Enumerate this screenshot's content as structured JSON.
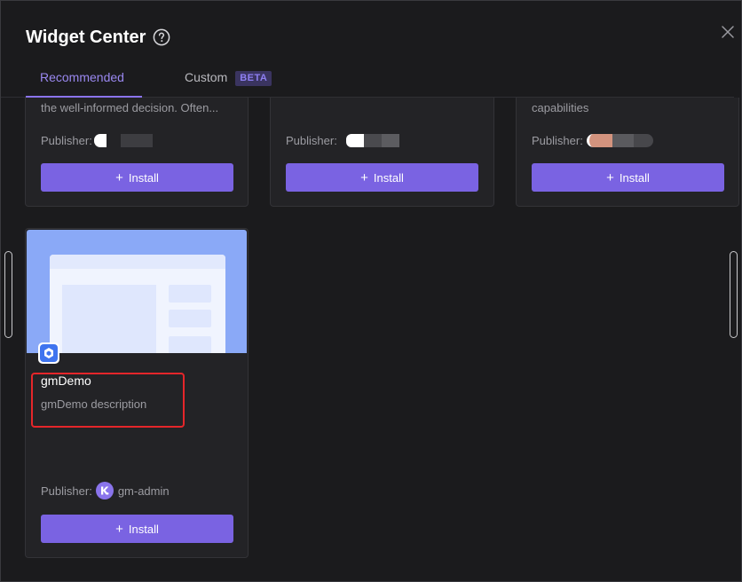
{
  "dialog": {
    "title": "Widget Center"
  },
  "tabs": [
    {
      "label": "Recommended",
      "active": true
    },
    {
      "label": "Custom",
      "badge": "BETA",
      "active": false
    }
  ],
  "publisher_label": "Publisher:",
  "install_label": "Install",
  "cards_top": [
    {
      "description": "the well-informed decision. Often..."
    },
    {
      "description": ""
    },
    {
      "description": "capabilities"
    }
  ],
  "widget": {
    "name": "gmDemo",
    "description": "gmDemo description",
    "publisher": "gm-admin"
  },
  "colors": {
    "accent": "#7a63e2",
    "highlight": "#e5262a",
    "preview_bg": "#8aa9f7"
  }
}
